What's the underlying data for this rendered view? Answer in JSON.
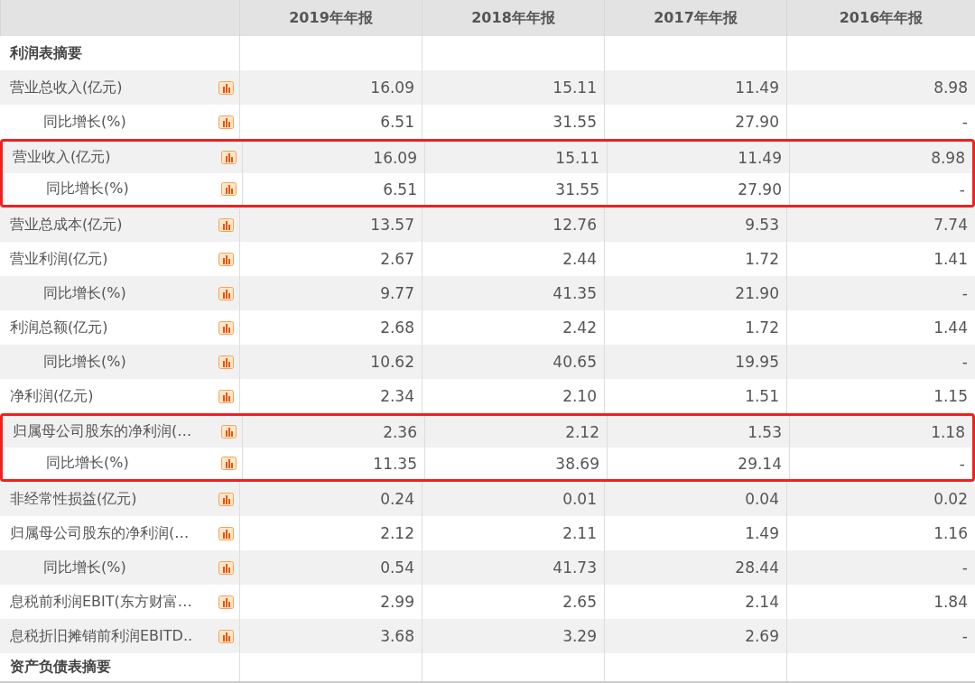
{
  "table": {
    "columns": [
      "2019年年报",
      "2018年年报",
      "2017年年报",
      "2016年年报"
    ],
    "rows": [
      {
        "kind": "section",
        "label": "利润表摘要",
        "highlighted": false,
        "values": []
      },
      {
        "kind": "metric",
        "label": "营业总收入(亿元)",
        "highlighted": false,
        "values": [
          "16.09",
          "15.11",
          "11.49",
          "8.98"
        ]
      },
      {
        "kind": "sub",
        "label": "同比增长(%)",
        "highlighted": false,
        "values": [
          "6.51",
          "31.55",
          "27.90",
          "-"
        ]
      },
      {
        "kind": "metric",
        "label": "营业收入(亿元)",
        "highlighted": true,
        "values": [
          "16.09",
          "15.11",
          "11.49",
          "8.98"
        ]
      },
      {
        "kind": "sub",
        "label": "同比增长(%)",
        "highlighted": true,
        "values": [
          "6.51",
          "31.55",
          "27.90",
          "-"
        ]
      },
      {
        "kind": "metric",
        "label": "营业总成本(亿元)",
        "highlighted": false,
        "values": [
          "13.57",
          "12.76",
          "9.53",
          "7.74"
        ]
      },
      {
        "kind": "metric",
        "label": "营业利润(亿元)",
        "highlighted": false,
        "values": [
          "2.67",
          "2.44",
          "1.72",
          "1.41"
        ]
      },
      {
        "kind": "sub",
        "label": "同比增长(%)",
        "highlighted": false,
        "values": [
          "9.77",
          "41.35",
          "21.90",
          "-"
        ]
      },
      {
        "kind": "metric",
        "label": "利润总额(亿元)",
        "highlighted": false,
        "values": [
          "2.68",
          "2.42",
          "1.72",
          "1.44"
        ]
      },
      {
        "kind": "sub",
        "label": "同比增长(%)",
        "highlighted": false,
        "values": [
          "10.62",
          "40.65",
          "19.95",
          "-"
        ]
      },
      {
        "kind": "metric",
        "label": "净利润(亿元)",
        "highlighted": false,
        "values": [
          "2.34",
          "2.10",
          "1.51",
          "1.15"
        ]
      },
      {
        "kind": "metric",
        "label": "归属母公司股东的净利润(…",
        "highlighted": true,
        "values": [
          "2.36",
          "2.12",
          "1.53",
          "1.18"
        ]
      },
      {
        "kind": "sub",
        "label": "同比增长(%)",
        "highlighted": true,
        "values": [
          "11.35",
          "38.69",
          "29.14",
          "-"
        ]
      },
      {
        "kind": "metric",
        "label": "非经常性损益(亿元)",
        "highlighted": false,
        "values": [
          "0.24",
          "0.01",
          "0.04",
          "0.02"
        ]
      },
      {
        "kind": "metric",
        "label": "归属母公司股东的净利润(…",
        "highlighted": false,
        "values": [
          "2.12",
          "2.11",
          "1.49",
          "1.16"
        ]
      },
      {
        "kind": "sub",
        "label": "同比增长(%)",
        "highlighted": false,
        "values": [
          "0.54",
          "41.73",
          "28.44",
          "-"
        ]
      },
      {
        "kind": "metric",
        "label": "息税前利润EBIT(东方财富…",
        "highlighted": false,
        "values": [
          "2.99",
          "2.65",
          "2.14",
          "1.84"
        ]
      },
      {
        "kind": "metric",
        "label": "息税折旧摊销前利润EBITD..",
        "highlighted": false,
        "values": [
          "3.68",
          "3.29",
          "2.69",
          "-"
        ]
      },
      {
        "kind": "section",
        "label": "资产负债表摘要",
        "highlighted": false,
        "values": []
      }
    ]
  }
}
